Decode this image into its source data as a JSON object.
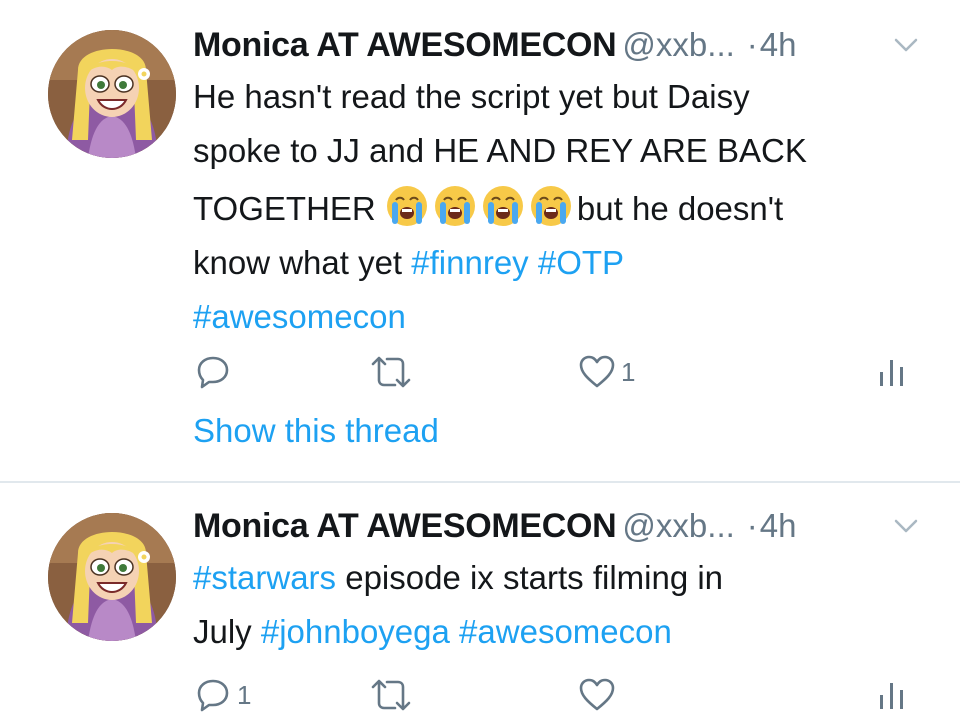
{
  "colors": {
    "link": "#1da1f2",
    "muted": "#657786",
    "text": "#14171a",
    "divider": "#e1e8ed"
  },
  "tweets": [
    {
      "author_name": "Monica AT AWESOMECON",
      "handle": "@xxb...",
      "dot": "·",
      "time": "4h",
      "lines": [
        {
          "text": "He hasn't read the script yet but Daisy"
        },
        {
          "text": "spoke to JJ and HE AND REY ARE BACK"
        },
        {
          "pre": "TOGETHER ",
          "emoji": "loudly-crying-face-emoji",
          "emoji_count": 4,
          "post": "but he doesn't"
        },
        {
          "pre": "know what yet ",
          "hashtags": [
            "#finnrey",
            "#OTP"
          ]
        },
        {
          "hashtags": [
            "#awesomecon"
          ]
        }
      ],
      "reply_count": "",
      "retweet_count": "",
      "like_count": "1",
      "show_thread": "Show this thread"
    },
    {
      "author_name": "Monica AT AWESOMECON",
      "handle": "@xxb...",
      "dot": "·",
      "time": "4h",
      "lines": [
        {
          "hashtag_first": "#starwars",
          "text": " episode ix starts filming in"
        },
        {
          "pre": "July ",
          "hashtags": [
            "#johnboyega",
            "#awesomecon"
          ]
        }
      ],
      "reply_count": "1",
      "retweet_count": "",
      "like_count": ""
    }
  ],
  "icons": {
    "reply": "reply-icon",
    "retweet": "retweet-icon",
    "like": "heart-icon",
    "analytics": "analytics-icon",
    "more": "chevron-down-icon"
  }
}
